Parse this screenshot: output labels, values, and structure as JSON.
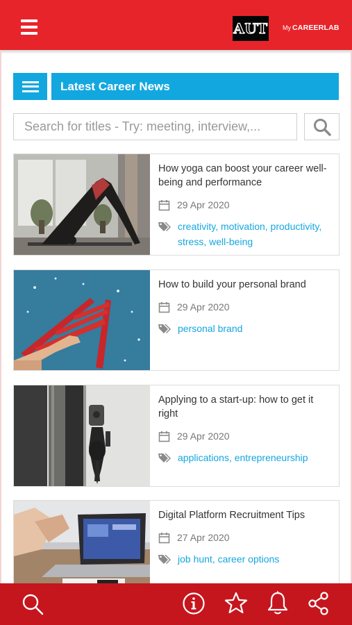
{
  "header": {
    "logo_text": "AUT",
    "brand_my": "My",
    "brand_name": "CAREERLAB",
    "menu_icon": "hamburger-icon",
    "color": "#e8242b"
  },
  "section": {
    "title": "Latest Career News",
    "menu_icon": "list-menu-icon",
    "color": "#13a7df"
  },
  "search": {
    "placeholder": "Search for titles - Try: meeting, interview,...",
    "value": "",
    "icon": "search-icon"
  },
  "articles": [
    {
      "title": "How yoga can boost your career well-being and performance",
      "date": "29 Apr 2020",
      "tags": "creativity, motivation, productivity, stress, well-being",
      "image": "yoga-pose-photo"
    },
    {
      "title": "How to build your personal brand",
      "date": "29 Apr 2020",
      "tags": "personal brand",
      "image": "red-ladder-photo"
    },
    {
      "title": "Applying to a start-up: how to get it right",
      "date": "29 Apr 2020",
      "tags": "applications, entrepreneurship",
      "image": "door-keys-photo"
    },
    {
      "title": "Digital Platform Recruitment Tips",
      "date": "27 Apr 2020",
      "tags": "job hunt, career options",
      "image": "laptop-meeting-photo"
    }
  ],
  "bottom_nav": {
    "color": "#c5161e",
    "icons": [
      "search-icon",
      "info-icon",
      "star-icon",
      "bell-icon",
      "share-icon"
    ]
  }
}
